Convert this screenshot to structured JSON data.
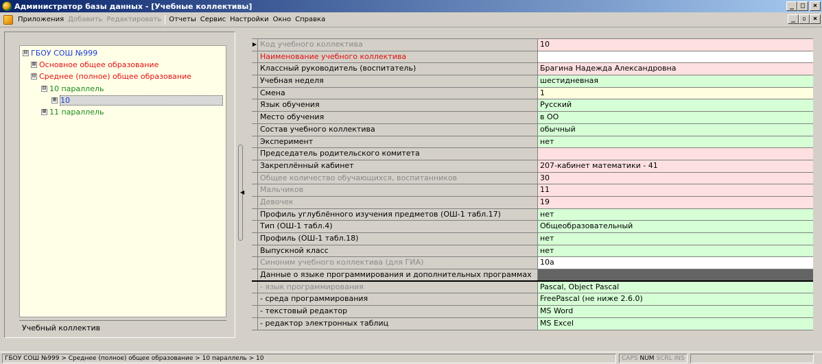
{
  "window": {
    "title": "Администратор базы данных - [Учебные коллективы]",
    "controls": [
      "_",
      "□",
      "×"
    ],
    "mdi_controls": [
      "_",
      "▫",
      "×"
    ]
  },
  "menu": {
    "items": [
      {
        "label": "Приложения",
        "enabled": true
      },
      {
        "label": "Добавить",
        "enabled": false
      },
      {
        "label": "Редактировать",
        "enabled": false
      },
      {
        "label": "Отчеты",
        "enabled": true
      },
      {
        "label": "Сервис",
        "enabled": true
      },
      {
        "label": "Настройки",
        "enabled": true
      },
      {
        "label": "Окно",
        "enabled": true
      },
      {
        "label": "Справка",
        "enabled": true
      }
    ]
  },
  "tree": {
    "nodes": [
      {
        "label": "ГБОУ СОШ №999",
        "expander": "⊟",
        "color": "blue"
      },
      {
        "label": "Основное общее образование",
        "expander": "⊞",
        "color": "red"
      },
      {
        "label": "Среднее (полное) общее образование",
        "expander": "⊟",
        "color": "red"
      },
      {
        "label": "10 параллель",
        "expander": "⊟",
        "color": "green"
      },
      {
        "label": "10",
        "expander": "⊞",
        "color": "blue",
        "selected": true
      },
      {
        "label": "11 параллель",
        "expander": "⊞",
        "color": "green"
      }
    ],
    "footer": "Учебный коллектив"
  },
  "grid": {
    "rows": [
      {
        "label": "Код учебного коллектива",
        "value": "10",
        "label_style": "gray",
        "value_style": "pink",
        "current": true
      },
      {
        "label": "Наименование учебного коллектива",
        "value": "",
        "label_style": "red",
        "value_style": "white"
      },
      {
        "label": "Классный руководитель (воспитатель)",
        "value": "Брагина  Надежда  Александровна",
        "label_style": "normal",
        "value_style": "pink"
      },
      {
        "label": "Учебная неделя",
        "value": "шестидневная",
        "label_style": "normal",
        "value_style": "green"
      },
      {
        "label": "Смена",
        "value": "1",
        "label_style": "normal",
        "value_style": "yellow"
      },
      {
        "label": "Язык обучения",
        "value": "Русский",
        "label_style": "normal",
        "value_style": "green"
      },
      {
        "label": "Место обучения",
        "value": "в ОО",
        "label_style": "normal",
        "value_style": "green"
      },
      {
        "label": "Состав учебного коллектива",
        "value": "обычный",
        "label_style": "normal",
        "value_style": "green"
      },
      {
        "label": "Эксперимент",
        "value": "нет",
        "label_style": "normal",
        "value_style": "green"
      },
      {
        "label": "Председатель родительского комитета",
        "value": "",
        "label_style": "normal",
        "value_style": "pink"
      },
      {
        "label": "Закреплённый кабинет",
        "value": "207-кабинет математики - 41",
        "label_style": "normal",
        "value_style": "pink"
      },
      {
        "label": "Общее количество обучающихся, воспитанников",
        "value": "30",
        "label_style": "gray",
        "value_style": "pink"
      },
      {
        "label": "Мальчиков",
        "value": "11",
        "label_style": "gray",
        "value_style": "pink"
      },
      {
        "label": "Девочек",
        "value": "19",
        "label_style": "gray",
        "value_style": "pink"
      },
      {
        "label": "Профиль углублённого изучения предметов (ОШ-1 табл.17)",
        "value": "нет",
        "label_style": "normal",
        "value_style": "green"
      },
      {
        "label": "Тип (ОШ-1 табл.4)",
        "value": "Общеобразовательный",
        "label_style": "normal",
        "value_style": "green"
      },
      {
        "label": "Профиль (ОШ-1 табл.18)",
        "value": "нет",
        "label_style": "normal",
        "value_style": "green"
      },
      {
        "label": "Выпускной класс",
        "value": "нет",
        "label_style": "normal",
        "value_style": "green"
      },
      {
        "label": "Синоним учебного коллектива (для ГИА)",
        "value": "10а",
        "label_style": "gray",
        "value_style": "white"
      },
      {
        "label": "Данные о языке программирования и дополнительных программах",
        "value": "",
        "label_style": "normal",
        "value_style": "dark",
        "section": true
      },
      {
        "label": "- язык программирования",
        "value": "Pascal, Object Pascal",
        "label_style": "gray",
        "value_style": "green"
      },
      {
        "label": "- среда программирования",
        "value": "FreePascal (не ниже 2.6.0)",
        "label_style": "normal",
        "value_style": "green"
      },
      {
        "label": "- текстовый редактор",
        "value": "MS Word",
        "label_style": "normal",
        "value_style": "green"
      },
      {
        "label": "- редактор электронных таблиц",
        "value": "MS Excel",
        "label_style": "normal",
        "value_style": "green"
      }
    ]
  },
  "status": {
    "path": "ГБОУ СОШ №999 > Среднее (полное) общее образование > 10 параллель > 10",
    "keys": [
      {
        "label": "CAPS",
        "on": false
      },
      {
        "label": "NUM",
        "on": true
      },
      {
        "label": "SCRL",
        "on": false
      },
      {
        "label": "INS",
        "on": false
      }
    ]
  },
  "colors": {
    "titlebar_start": "#0a246a",
    "titlebar_end": "#a6caf0",
    "value_pink": "#ffe0e0",
    "value_green": "#d6ffd6",
    "value_yellow": "#ffffe0",
    "tree_background": "#ffffe8"
  }
}
